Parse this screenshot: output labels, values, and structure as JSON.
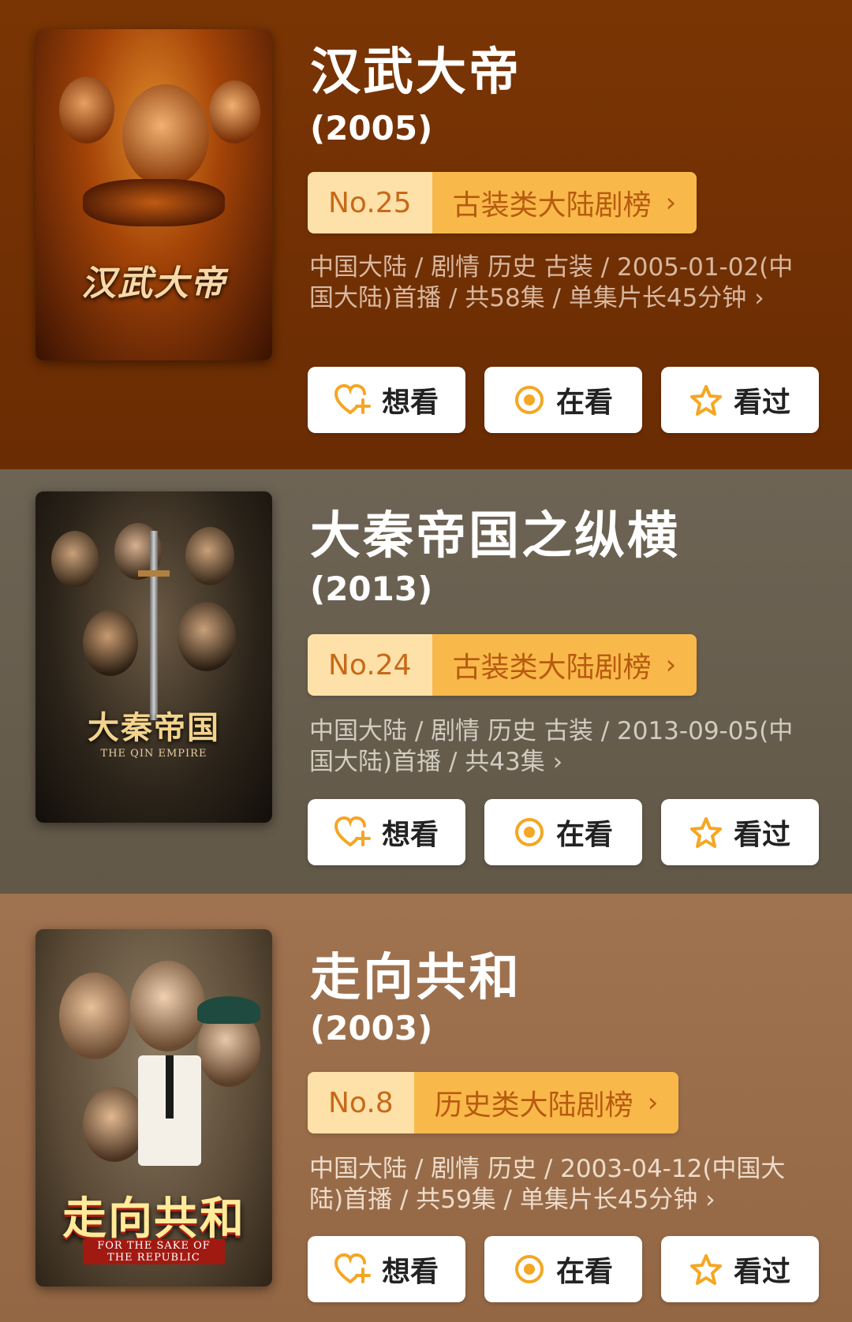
{
  "colors": {
    "rank_number_bg": "#fde1a8",
    "rank_list_bg": "#f9b94a",
    "rank_text": "#c8691a",
    "button_bg": "#ffffff",
    "icon_orange": "#f5a623"
  },
  "items": [
    {
      "title": "汉武大帝",
      "year": "(2005)",
      "rank_number": "No.25",
      "rank_list": "古装类大陆剧榜",
      "rank_chevron": "›",
      "meta": "中国大陆 / 剧情 历史 古装 / 2005-01-02(中国大陆)首播 / 共58集 / 单集片长45分钟",
      "meta_chevron": "›",
      "poster_title": "汉武大帝",
      "poster_sub": "",
      "actions": {
        "want": "想看",
        "watching": "在看",
        "watched": "看过"
      }
    },
    {
      "title": "大秦帝国之纵横",
      "year": "(2013)",
      "rank_number": "No.24",
      "rank_list": "古装类大陆剧榜",
      "rank_chevron": "›",
      "meta": "中国大陆 / 剧情 历史 古装 / 2013-09-05(中国大陆)首播 / 共43集",
      "meta_chevron": "›",
      "poster_title": "大秦帝国",
      "poster_sub": "THE QIN EMPIRE",
      "actions": {
        "want": "想看",
        "watching": "在看",
        "watched": "看过"
      }
    },
    {
      "title": "走向共和",
      "year": "(2003)",
      "rank_number": "No.8",
      "rank_list": "历史类大陆剧榜",
      "rank_chevron": "›",
      "meta": "中国大陆 / 剧情 历史 / 2003-04-12(中国大陆)首播 / 共59集 / 单集片长45分钟",
      "meta_chevron": "›",
      "poster_title": "走向共和",
      "poster_sub": "FOR THE SAKE OF THE REPUBLIC",
      "actions": {
        "want": "想看",
        "watching": "在看",
        "watched": "看过"
      }
    }
  ],
  "icons": {
    "want": "heart-plus-icon",
    "watching": "target-circle-icon",
    "watched": "star-icon"
  }
}
